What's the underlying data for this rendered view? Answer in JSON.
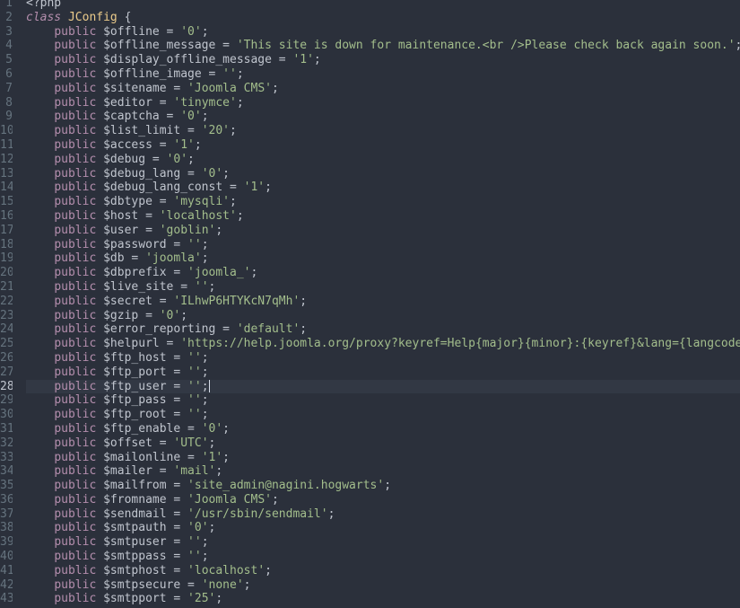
{
  "editor": {
    "active_line": 28,
    "colors": {
      "background": "#2b303b",
      "keyword": "#b48ead",
      "class_name": "#ebcb8b",
      "string": "#a3be8c",
      "text": "#c0c5ce",
      "line_number": "#65737e"
    },
    "lines": [
      {
        "n": "1",
        "kind": "open",
        "text": "<?php"
      },
      {
        "n": "2",
        "kind": "class",
        "kw": "class",
        "name": "JConfig",
        "rest": " {"
      },
      {
        "n": "3",
        "kind": "prop",
        "kw": "public",
        "var": "$offline",
        "val": "'0'"
      },
      {
        "n": "4",
        "kind": "prop",
        "kw": "public",
        "var": "$offline_message",
        "val": "'This site is down for maintenance.<br />Please check back again soon.'"
      },
      {
        "n": "5",
        "kind": "prop",
        "kw": "public",
        "var": "$display_offline_message",
        "val": "'1'"
      },
      {
        "n": "6",
        "kind": "prop",
        "kw": "public",
        "var": "$offline_image",
        "val": "''"
      },
      {
        "n": "7",
        "kind": "prop",
        "kw": "public",
        "var": "$sitename",
        "val": "'Joomla CMS'"
      },
      {
        "n": "8",
        "kind": "prop",
        "kw": "public",
        "var": "$editor",
        "val": "'tinymce'"
      },
      {
        "n": "9",
        "kind": "prop",
        "kw": "public",
        "var": "$captcha",
        "val": "'0'"
      },
      {
        "n": "10",
        "kind": "prop",
        "kw": "public",
        "var": "$list_limit",
        "val": "'20'"
      },
      {
        "n": "11",
        "kind": "prop",
        "kw": "public",
        "var": "$access",
        "val": "'1'"
      },
      {
        "n": "12",
        "kind": "prop",
        "kw": "public",
        "var": "$debug",
        "val": "'0'"
      },
      {
        "n": "13",
        "kind": "prop",
        "kw": "public",
        "var": "$debug_lang",
        "val": "'0'"
      },
      {
        "n": "14",
        "kind": "prop",
        "kw": "public",
        "var": "$debug_lang_const",
        "val": "'1'"
      },
      {
        "n": "15",
        "kind": "prop",
        "kw": "public",
        "var": "$dbtype",
        "val": "'mysqli'"
      },
      {
        "n": "16",
        "kind": "prop",
        "kw": "public",
        "var": "$host",
        "val": "'localhost'"
      },
      {
        "n": "17",
        "kind": "prop",
        "kw": "public",
        "var": "$user",
        "val": "'goblin'"
      },
      {
        "n": "18",
        "kind": "prop",
        "kw": "public",
        "var": "$password",
        "val": "''"
      },
      {
        "n": "19",
        "kind": "prop",
        "kw": "public",
        "var": "$db",
        "val": "'joomla'"
      },
      {
        "n": "20",
        "kind": "prop",
        "kw": "public",
        "var": "$dbprefix",
        "val": "'joomla_'"
      },
      {
        "n": "21",
        "kind": "prop",
        "kw": "public",
        "var": "$live_site",
        "val": "''"
      },
      {
        "n": "22",
        "kind": "prop",
        "kw": "public",
        "var": "$secret",
        "val": "'ILhwP6HTYKcN7qMh'"
      },
      {
        "n": "23",
        "kind": "prop",
        "kw": "public",
        "var": "$gzip",
        "val": "'0'"
      },
      {
        "n": "24",
        "kind": "prop",
        "kw": "public",
        "var": "$error_reporting",
        "val": "'default'"
      },
      {
        "n": "25",
        "kind": "prop",
        "kw": "public",
        "var": "$helpurl",
        "val": "'https://help.joomla.org/proxy?keyref=Help{major}{minor}:{keyref}&lang={langcode}'"
      },
      {
        "n": "26",
        "kind": "prop",
        "kw": "public",
        "var": "$ftp_host",
        "val": "''"
      },
      {
        "n": "27",
        "kind": "prop",
        "kw": "public",
        "var": "$ftp_port",
        "val": "''"
      },
      {
        "n": "28",
        "kind": "prop",
        "kw": "public",
        "var": "$ftp_user",
        "val": "''",
        "caret": true
      },
      {
        "n": "29",
        "kind": "prop",
        "kw": "public",
        "var": "$ftp_pass",
        "val": "''"
      },
      {
        "n": "30",
        "kind": "prop",
        "kw": "public",
        "var": "$ftp_root",
        "val": "''"
      },
      {
        "n": "31",
        "kind": "prop",
        "kw": "public",
        "var": "$ftp_enable",
        "val": "'0'"
      },
      {
        "n": "32",
        "kind": "prop",
        "kw": "public",
        "var": "$offset",
        "val": "'UTC'"
      },
      {
        "n": "33",
        "kind": "prop",
        "kw": "public",
        "var": "$mailonline",
        "val": "'1'"
      },
      {
        "n": "34",
        "kind": "prop",
        "kw": "public",
        "var": "$mailer",
        "val": "'mail'"
      },
      {
        "n": "35",
        "kind": "prop",
        "kw": "public",
        "var": "$mailfrom",
        "val": "'site_admin@nagini.hogwarts'"
      },
      {
        "n": "36",
        "kind": "prop",
        "kw": "public",
        "var": "$fromname",
        "val": "'Joomla CMS'"
      },
      {
        "n": "37",
        "kind": "prop",
        "kw": "public",
        "var": "$sendmail",
        "val": "'/usr/sbin/sendmail'"
      },
      {
        "n": "38",
        "kind": "prop",
        "kw": "public",
        "var": "$smtpauth",
        "val": "'0'"
      },
      {
        "n": "39",
        "kind": "prop",
        "kw": "public",
        "var": "$smtpuser",
        "val": "''"
      },
      {
        "n": "40",
        "kind": "prop",
        "kw": "public",
        "var": "$smtppass",
        "val": "''"
      },
      {
        "n": "41",
        "kind": "prop",
        "kw": "public",
        "var": "$smtphost",
        "val": "'localhost'"
      },
      {
        "n": "42",
        "kind": "prop",
        "kw": "public",
        "var": "$smtpsecure",
        "val": "'none'"
      },
      {
        "n": "43",
        "kind": "prop",
        "kw": "public",
        "var": "$smtpport",
        "val": "'25'"
      }
    ]
  }
}
